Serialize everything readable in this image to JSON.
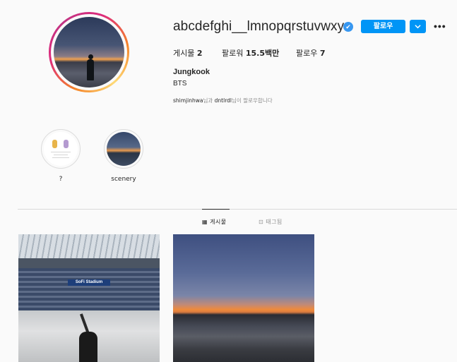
{
  "profile": {
    "username": "abcdefghi__lmnopqrstuvwxyz",
    "verified_mark": "✔",
    "follow_label": "팔로우",
    "dropdown_icon": "chevron-down-icon",
    "more_label": "•••",
    "stats": {
      "posts_label": "게시물",
      "posts_count": "2",
      "followers_label": "팔로워",
      "followers_count": "15.5백만",
      "following_label": "팔로우",
      "following_count": "7"
    },
    "full_name": "Jungkook",
    "bio": "BTS",
    "followed_by": {
      "user1": "shimjinhwa",
      "connector": "님과",
      "user2": "dntlrdl",
      "suffix": "님이 팔로우합니다"
    }
  },
  "highlights": [
    {
      "label": "?"
    },
    {
      "label": "scenery"
    }
  ],
  "tabs": [
    {
      "label": "게시물",
      "icon": "grid-icon",
      "active": true
    },
    {
      "label": "태그됨",
      "icon": "tag-icon",
      "active": false
    }
  ],
  "posts": [
    {
      "caption_text": "SoFi Stadium"
    },
    {
      "caption_text": ""
    }
  ],
  "colors": {
    "accent": "#0095f6",
    "verified": "#3897f0",
    "text": "#262626",
    "muted": "#8e8e8e",
    "border": "#dbdbdb",
    "background": "#fafafa"
  }
}
